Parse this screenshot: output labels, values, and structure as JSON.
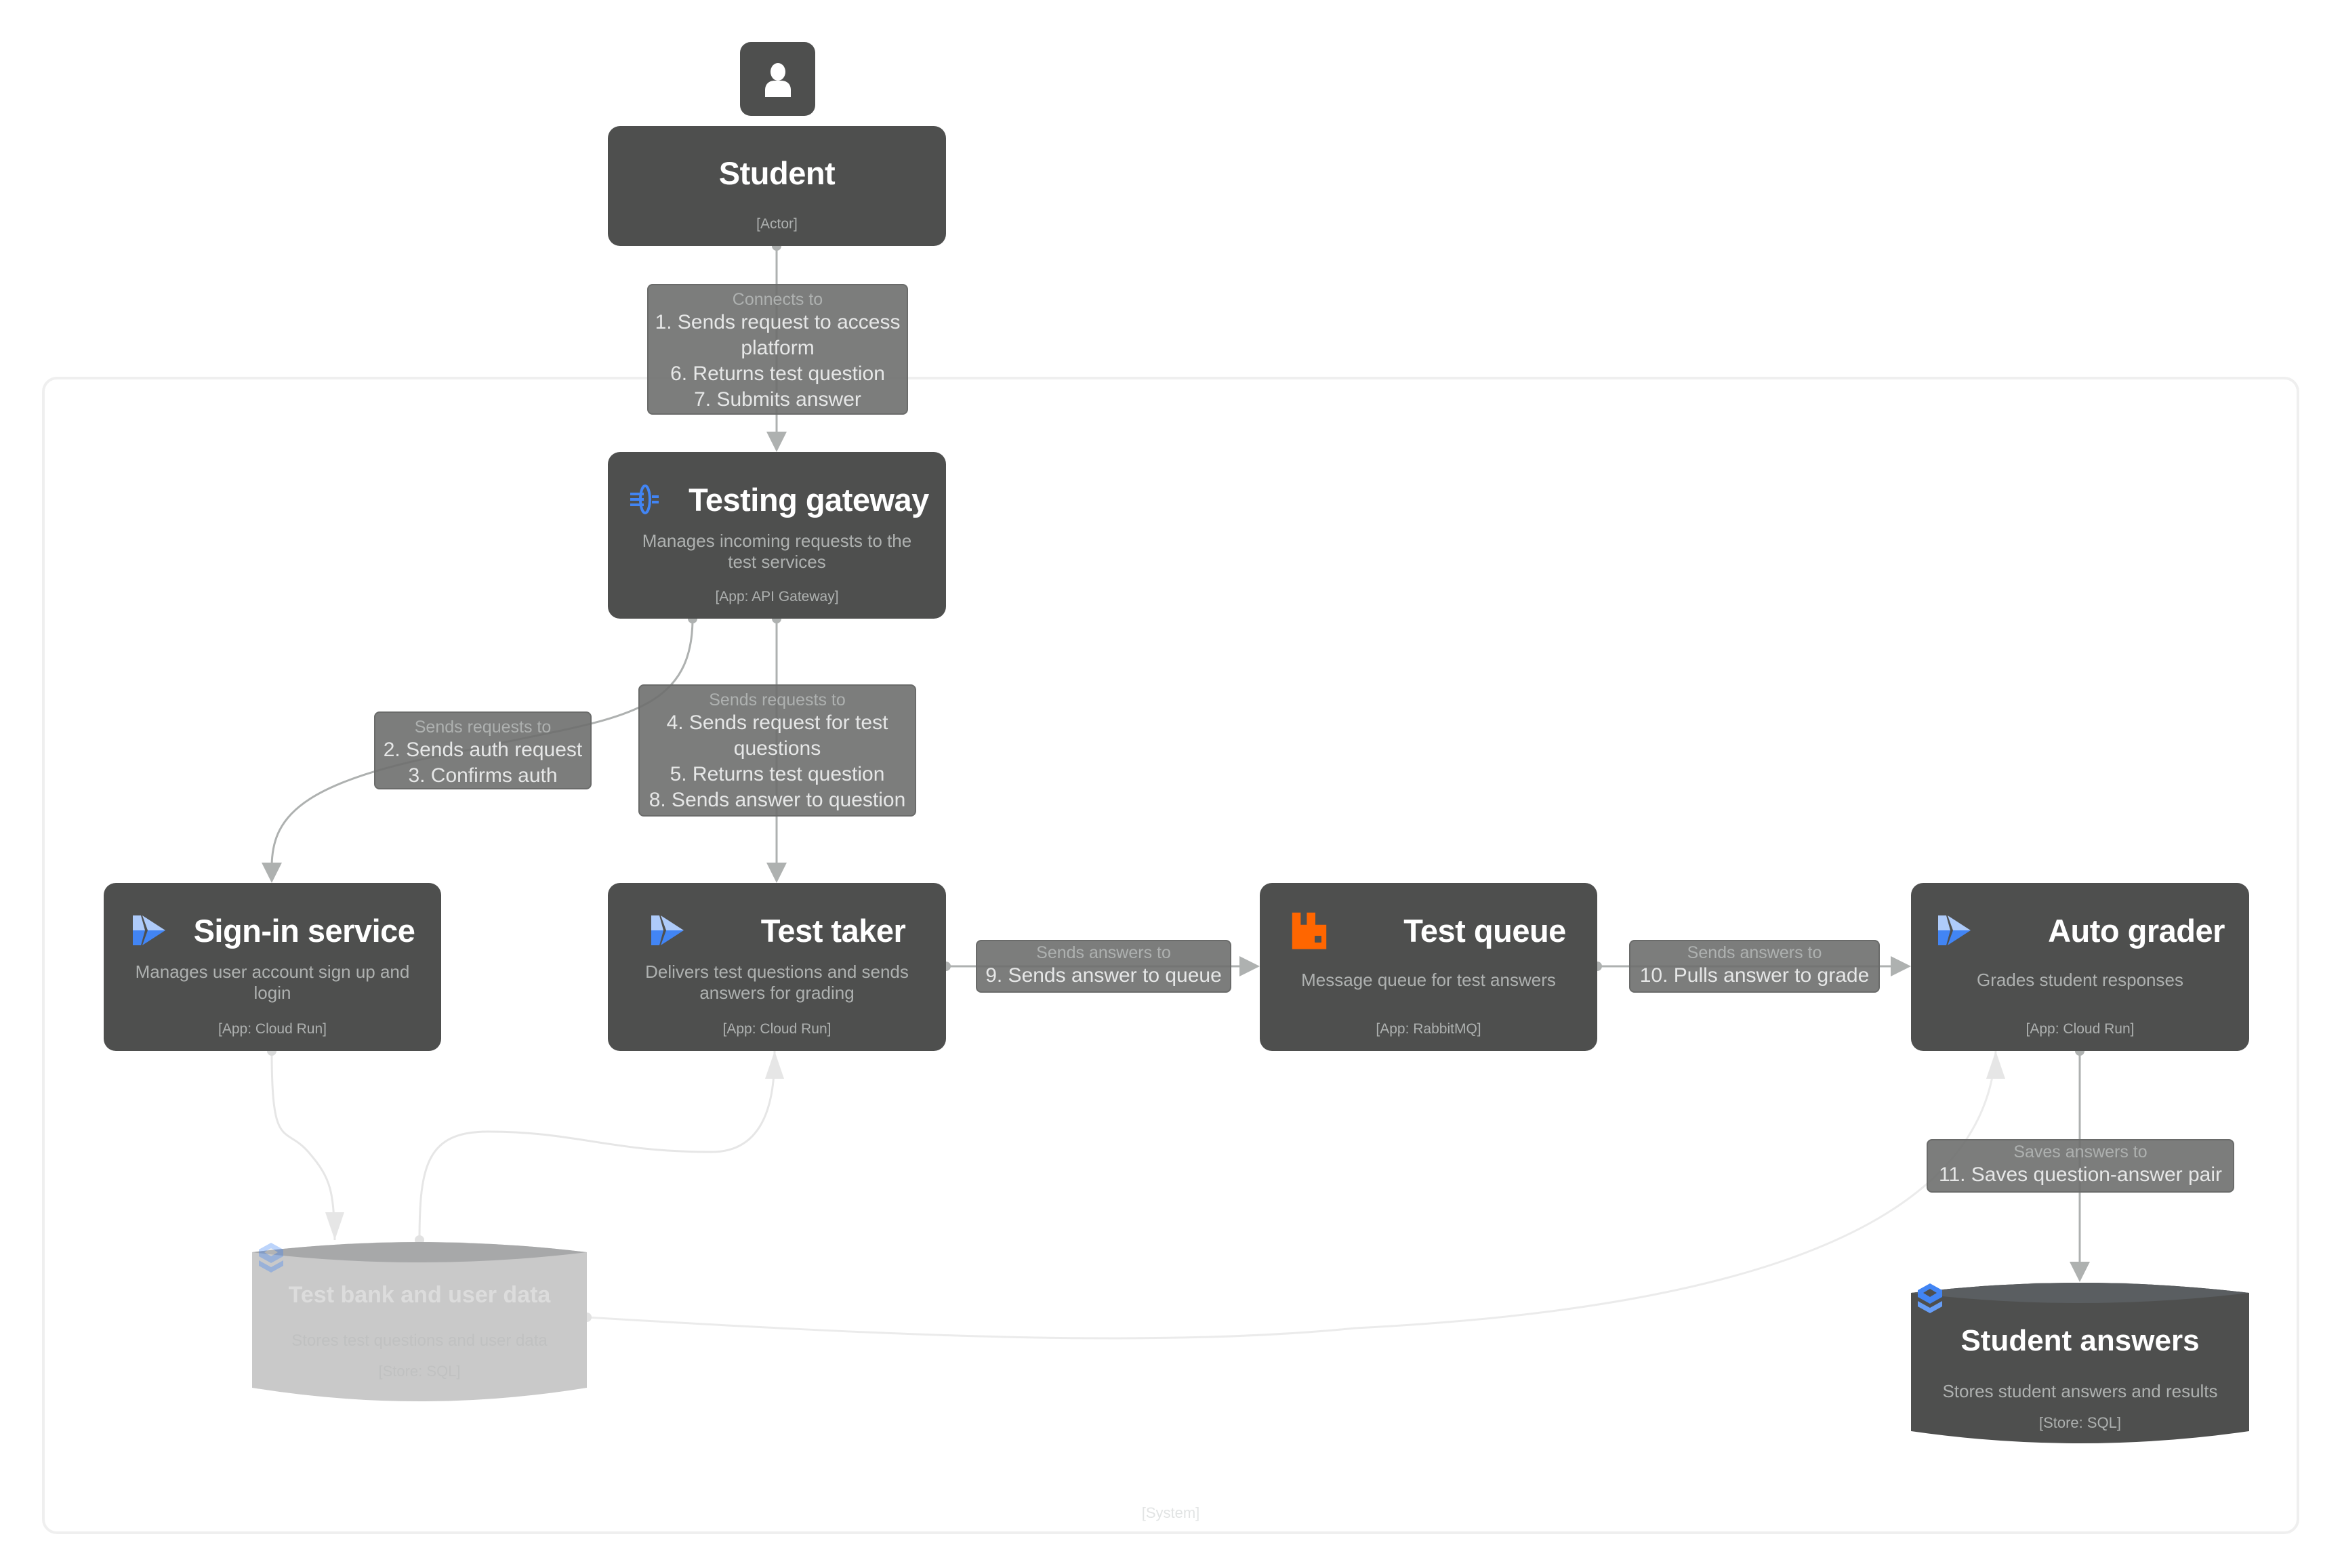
{
  "diagram": {
    "boundary_label": "[System]",
    "colors": {
      "node_fill": "#4e4f4e",
      "label_fill": "#7a7b7a",
      "edge": "#aeb1b0",
      "edge_faded": "#e6e6e6",
      "boundary": "#efefef",
      "cloud_run_blue": "#4285f4",
      "rabbitmq_orange": "#ff6600"
    },
    "nodes": {
      "student": {
        "title": "Student",
        "tech": "[Actor]",
        "icon": "user-icon"
      },
      "gateway": {
        "title": "Testing gateway",
        "desc": "Manages incoming requests to the test services",
        "tech": "[App: API Gateway]",
        "icon": "api-gateway-icon"
      },
      "signin": {
        "title": "Sign-in service",
        "desc": "Manages user account sign up and login",
        "tech": "[App: Cloud Run]",
        "icon": "cloud-run-icon"
      },
      "taker": {
        "title": "Test taker",
        "desc": "Delivers test questions and sends answers for grading",
        "tech": "[App: Cloud Run]",
        "icon": "cloud-run-icon"
      },
      "queue": {
        "title": "Test queue",
        "desc": "Message queue for test answers",
        "tech": "[App: RabbitMQ]",
        "icon": "rabbitmq-icon"
      },
      "grader": {
        "title": "Auto grader",
        "desc": "Grades student responses",
        "tech": "[App: Cloud Run]",
        "icon": "cloud-run-icon"
      },
      "testbank": {
        "title": "Test bank and user data",
        "desc": "Stores test questions and user data",
        "tech": "[Store: SQL]",
        "icon": "cloud-sql-icon"
      },
      "answers": {
        "title": "Student answers",
        "desc": "Stores student answers and results",
        "tech": "[Store: SQL]",
        "icon": "cloud-sql-icon"
      }
    },
    "edges": {
      "student_gateway": {
        "header": "Connects to",
        "lines": [
          "1. Sends request to access",
          "platform",
          "6. Returns test question",
          "7. Submits answer"
        ]
      },
      "gateway_signin": {
        "header": "Sends requests to",
        "lines": [
          "2. Sends auth request",
          "3. Confirms auth"
        ]
      },
      "gateway_taker": {
        "header": "Sends requests to",
        "lines": [
          "4. Sends request for test",
          "questions",
          "5. Returns test question",
          "8. Sends answer to question"
        ]
      },
      "taker_queue": {
        "header": "Sends answers to",
        "lines": [
          "9. Sends answer to queue"
        ]
      },
      "queue_grader": {
        "header": "Sends answers to",
        "lines": [
          "10. Pulls answer to grade"
        ]
      },
      "grader_answers": {
        "header": "Saves answers to",
        "lines": [
          "11. Saves question-answer pair"
        ]
      }
    }
  }
}
